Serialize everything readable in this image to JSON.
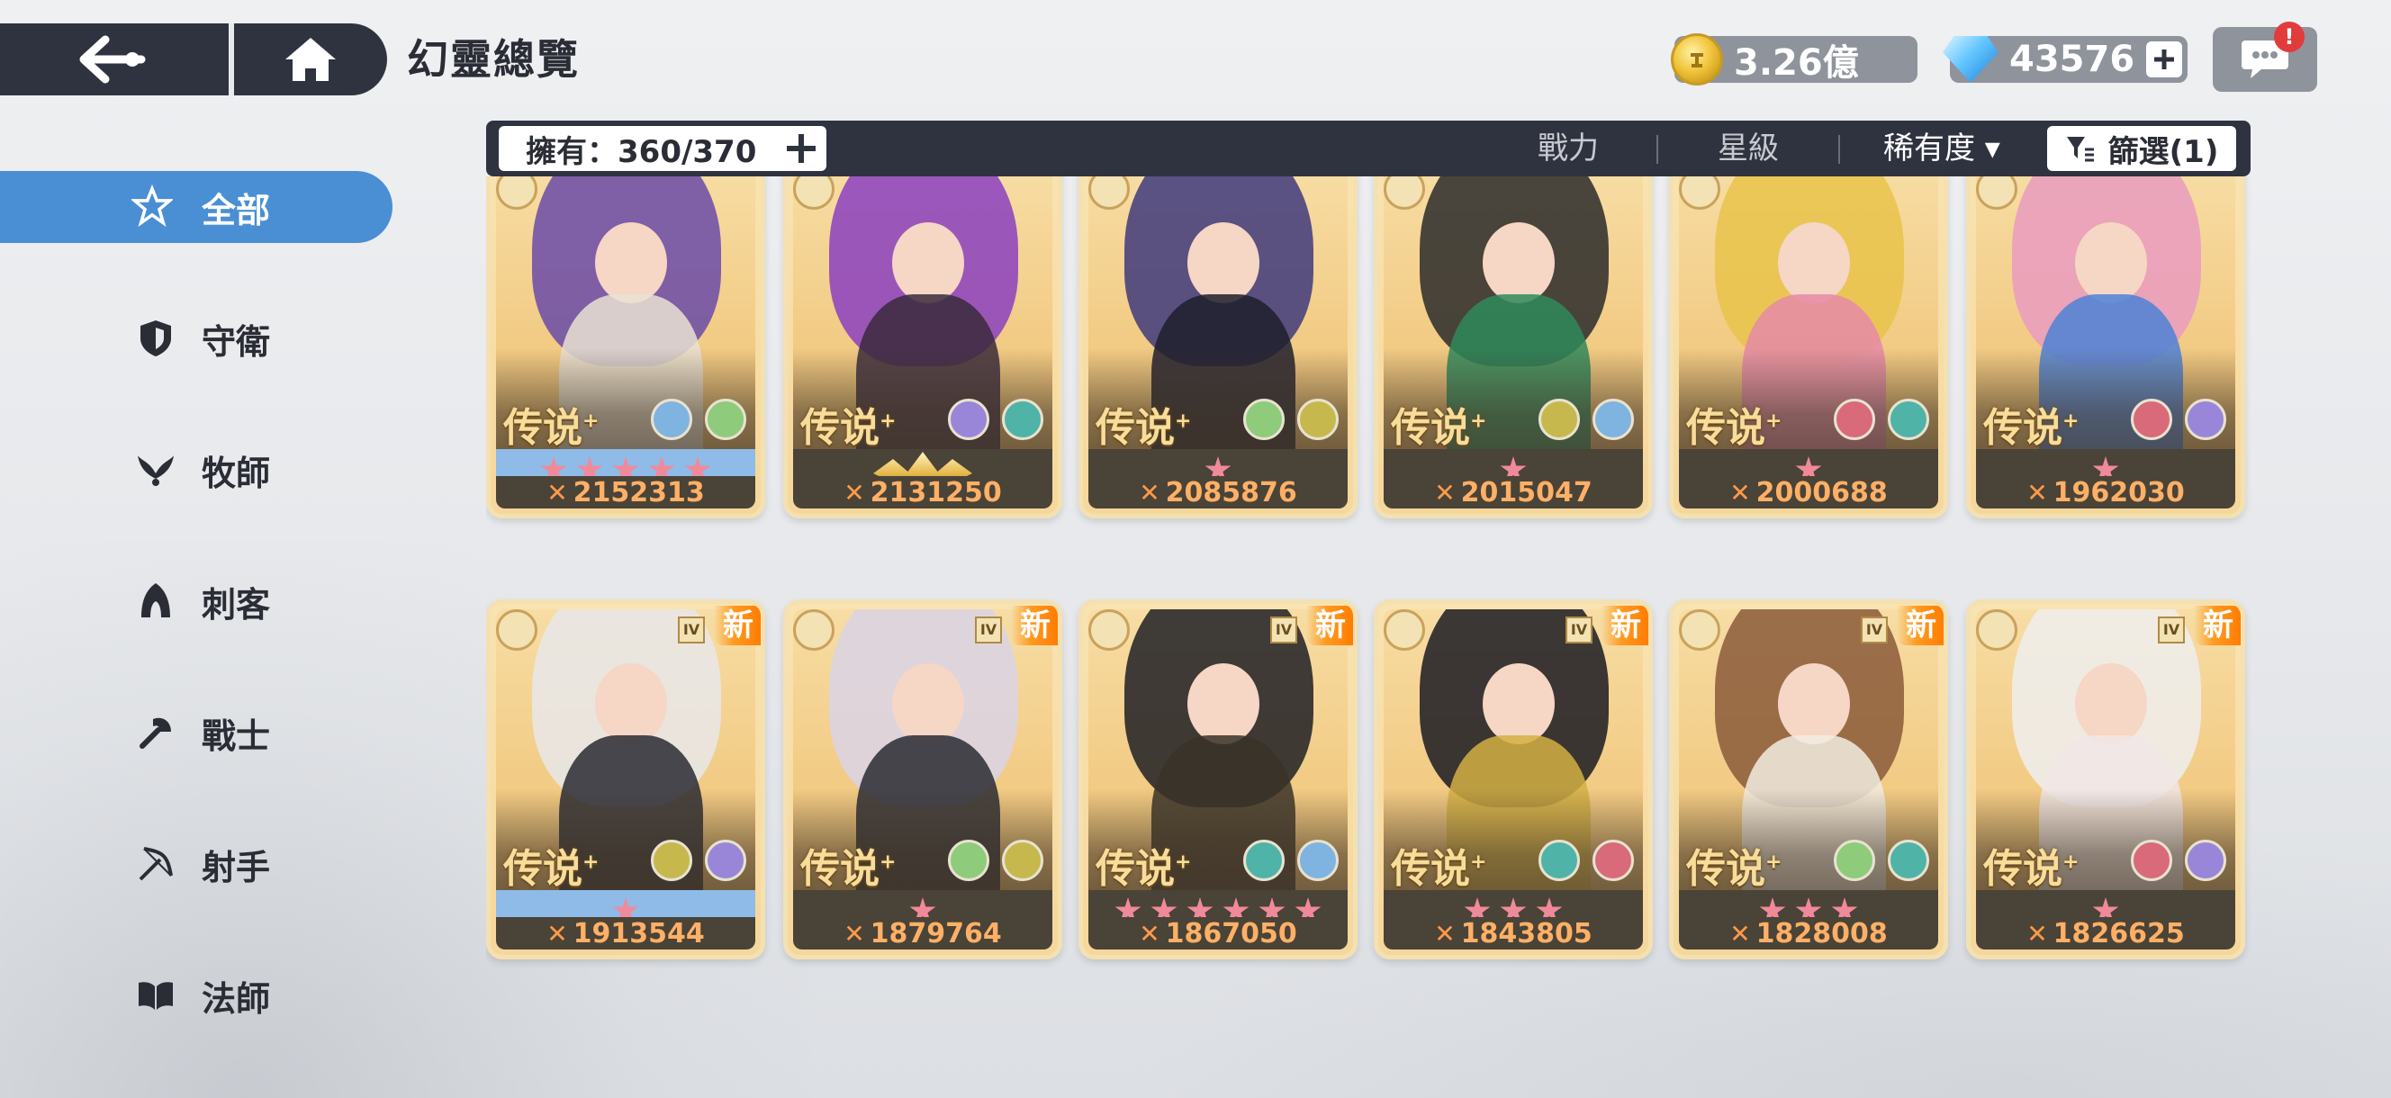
{
  "header": {
    "title": "幻靈總覽",
    "back_icon": "back-arrow-icon",
    "home_icon": "home-icon"
  },
  "currencies": {
    "gold": "3.26億",
    "gems": "43576",
    "plus": "+"
  },
  "chat": {
    "alert": "!"
  },
  "filter_bar": {
    "owned_label": "擁有：360/370",
    "sort_power": "戰力",
    "sort_star": "星級",
    "sort_rarity": "稀有度 ▾",
    "filter_label": "篩選(1)"
  },
  "sidebar": {
    "items": [
      {
        "label": "全部",
        "icon": "star-outline-icon"
      },
      {
        "label": "守衛",
        "icon": "shield-icon"
      },
      {
        "label": "牧師",
        "icon": "wings-icon"
      },
      {
        "label": "刺客",
        "icon": "hood-icon"
      },
      {
        "label": "戰士",
        "icon": "axe-icon"
      },
      {
        "label": "射手",
        "icon": "bow-icon"
      },
      {
        "label": "法師",
        "icon": "book-icon"
      }
    ]
  },
  "cards": [
    {
      "rank": "传说",
      "power": "2152313",
      "stars": 5,
      "star_style": "blue",
      "new": "",
      "lv": "",
      "elements": [
        "#7fb3e0",
        "#8ecb7a"
      ],
      "colors": [
        "#6a4aa8",
        "#e9e2d3"
      ]
    },
    {
      "rank": "传说",
      "power": "2131250",
      "stars": 0,
      "star_style": "crown",
      "new": "",
      "lv": "",
      "elements": [
        "#9a86d8",
        "#4fb3a8"
      ],
      "colors": [
        "#8b3fbf",
        "#3a2a3c"
      ]
    },
    {
      "rank": "传说",
      "power": "2085876",
      "stars": 1,
      "star_style": "dark",
      "new": "",
      "lv": "",
      "elements": [
        "#8ecb7a",
        "#c6b84d"
      ],
      "colors": [
        "#3e3a7c",
        "#1f1d2c"
      ]
    },
    {
      "rank": "传说",
      "power": "2015047",
      "stars": 1,
      "star_style": "dark",
      "new": "",
      "lv": "",
      "elements": [
        "#c6b84d",
        "#7fb3e0"
      ],
      "colors": [
        "#2a2a2a",
        "#2f8a5c"
      ]
    },
    {
      "rank": "传说",
      "power": "2000688",
      "stars": 1,
      "star_style": "dark",
      "new": "",
      "lv": "",
      "elements": [
        "#d86a7a",
        "#4fb3a8"
      ],
      "colors": [
        "#e8c34a",
        "#e58aa8"
      ]
    },
    {
      "rank": "传说",
      "power": "1962030",
      "stars": 1,
      "star_style": "dark",
      "new": "",
      "lv": "",
      "elements": [
        "#d86a7a",
        "#9a86d8"
      ],
      "colors": [
        "#e99bbf",
        "#4d82d6"
      ]
    },
    {
      "rank": "传说",
      "power": "1913544",
      "stars": 1,
      "star_style": "blue",
      "new": "新",
      "lv": "IV",
      "elements": [
        "#c6b84d",
        "#9a86d8"
      ],
      "colors": [
        "#e7e7ea",
        "#2a2a32"
      ]
    },
    {
      "rank": "传说",
      "power": "1879764",
      "stars": 1,
      "star_style": "dark",
      "new": "新",
      "lv": "IV",
      "elements": [
        "#8ecb7a",
        "#c6b84d"
      ],
      "colors": [
        "#d9d3e6",
        "#2a2a32"
      ]
    },
    {
      "rank": "传说",
      "power": "1867050",
      "stars": 6,
      "star_style": "dark",
      "new": "新",
      "lv": "IV",
      "elements": [
        "#4fb3a8",
        "#7fb3e0"
      ],
      "colors": [
        "#1e1e24",
        "#3a3228"
      ]
    },
    {
      "rank": "传说",
      "power": "1843805",
      "stars": 3,
      "star_style": "dark",
      "new": "新",
      "lv": "IV",
      "elements": [
        "#4fb3a8",
        "#d86a7a"
      ],
      "colors": [
        "#1a1a22",
        "#d4b044"
      ]
    },
    {
      "rank": "传说",
      "power": "1828008",
      "stars": 3,
      "star_style": "dark",
      "new": "新",
      "lv": "IV",
      "elements": [
        "#8ecb7a",
        "#4fb3a8"
      ],
      "colors": [
        "#8a5a3a",
        "#f2ece2"
      ]
    },
    {
      "rank": "传说",
      "power": "1826625",
      "stars": 1,
      "star_style": "dark",
      "new": "新",
      "lv": "IV",
      "elements": [
        "#d86a7a",
        "#9a86d8"
      ],
      "colors": [
        "#eeeeee",
        "#f1e6e6"
      ]
    }
  ]
}
